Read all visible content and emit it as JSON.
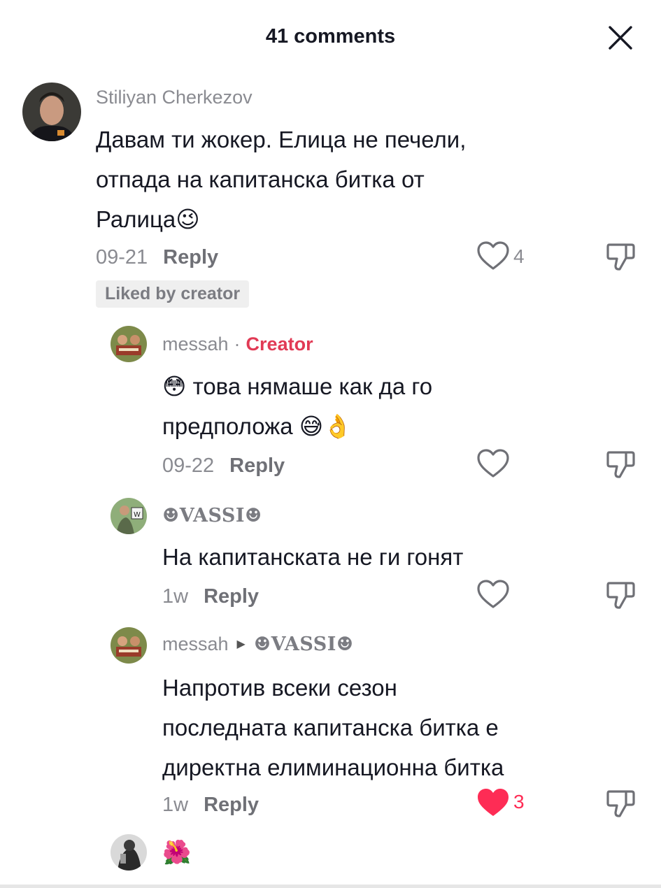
{
  "header": {
    "title": "41 comments",
    "close_icon": "close-icon"
  },
  "comments": [
    {
      "username": "Stiliyan Cherkezov",
      "lines": [
        "Давам ти жокер. Елица не печели,",
        "отпада на капитанска битка от",
        "Ралица😉"
      ],
      "date": "09-21",
      "reply_label": "Reply",
      "like_count": "4",
      "liked_by_creator": "Liked by creator"
    },
    {
      "username": "messah",
      "separator": "·",
      "badge": "Creator",
      "lines": [
        "😳 това нямаше как да го",
        "предположа 😅👌"
      ],
      "date": "09-22",
      "reply_label": "Reply"
    },
    {
      "username": "☻VASSI☻",
      "lines": [
        "На капитанската не ги гонят"
      ],
      "date": "1w",
      "reply_label": "Reply"
    },
    {
      "username": "messah",
      "reply_to": "☻VASSI☻",
      "lines": [
        "Напротив всеки сезон",
        "последната капитанска битка е",
        "директна елиминационна битка"
      ],
      "date": "1w",
      "reply_label": "Reply",
      "like_count": "3",
      "liked": true
    },
    {
      "lines": [
        "🌺"
      ]
    }
  ],
  "colors": {
    "accent": "#fe2c55",
    "creator": "#e13a55",
    "muted": "#8a8b91",
    "text": "#161823"
  }
}
